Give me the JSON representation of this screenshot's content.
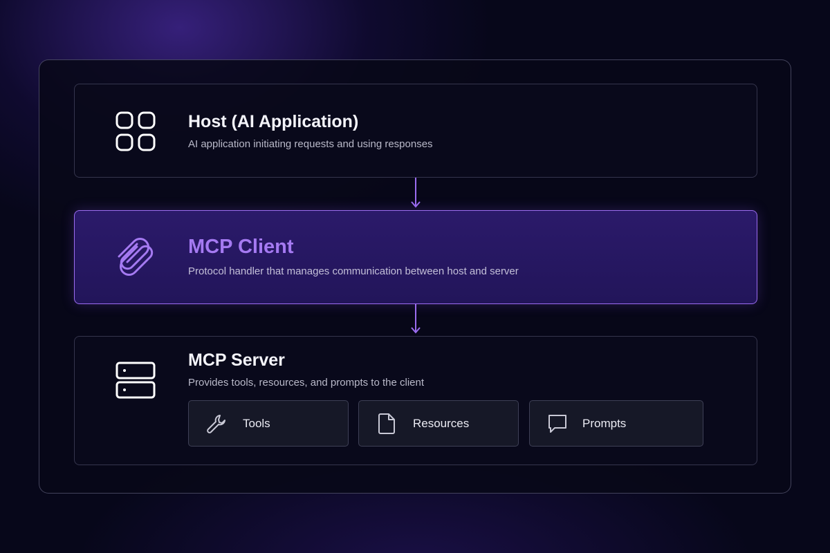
{
  "host": {
    "title": "Host (AI Application)",
    "description": "AI application initiating requests and using responses",
    "icon": "grid-icon"
  },
  "client": {
    "title": "MCP Client",
    "description": "Protocol handler that manages communication between host and server",
    "icon": "paperclip-icon"
  },
  "server": {
    "title": "MCP Server",
    "description": "Provides tools, resources, and prompts to the client",
    "icon": "server-icon",
    "capabilities": [
      {
        "label": "Tools",
        "icon": "wrench-icon"
      },
      {
        "label": "Resources",
        "icon": "file-icon"
      },
      {
        "label": "Prompts",
        "icon": "message-icon"
      }
    ]
  },
  "colors": {
    "accent": "#9b6cf0",
    "accent_text": "#a57af2",
    "background": "#07071a"
  }
}
